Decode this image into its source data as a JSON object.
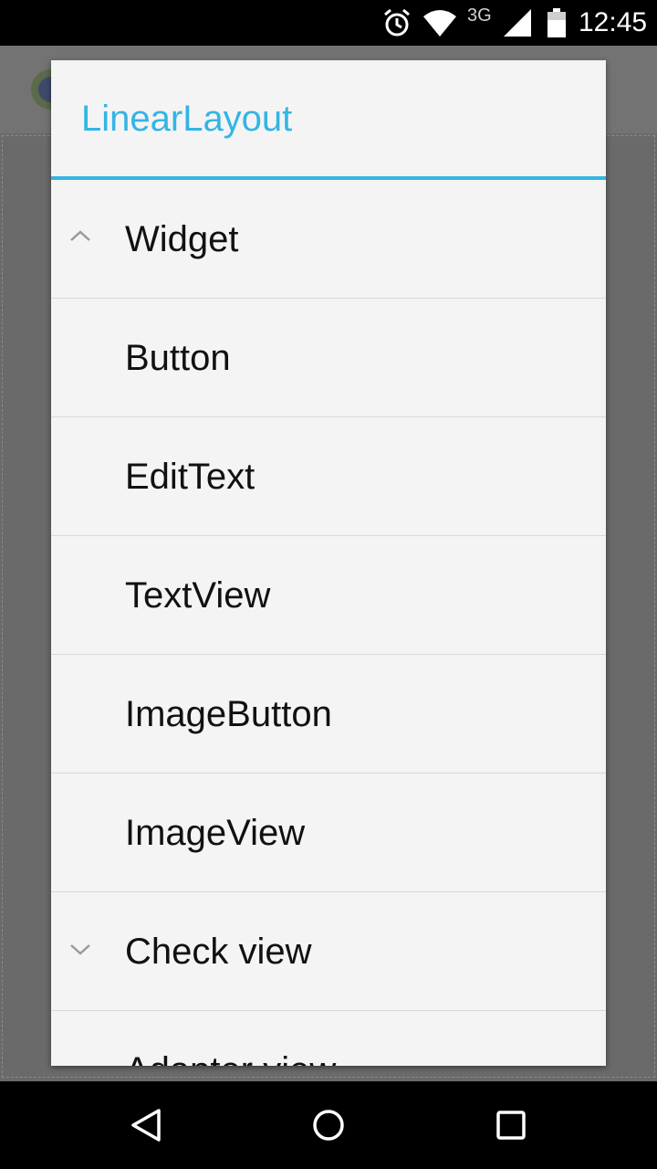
{
  "status_bar": {
    "network": "3G",
    "time": "12:45",
    "icons": [
      "alarm-icon",
      "wifi-icon",
      "signal-icon",
      "battery-icon"
    ]
  },
  "dialog": {
    "title": "LinearLayout",
    "accent_color": "#33b5e5",
    "items": [
      {
        "label": "Widget",
        "type": "group",
        "state": "expanded",
        "icon": "chevron-up-icon"
      },
      {
        "label": "Button",
        "type": "child"
      },
      {
        "label": "EditText",
        "type": "child"
      },
      {
        "label": "TextView",
        "type": "child"
      },
      {
        "label": "ImageButton",
        "type": "child"
      },
      {
        "label": "ImageView",
        "type": "child"
      },
      {
        "label": "Check view",
        "type": "group",
        "state": "collapsed",
        "icon": "chevron-down-icon"
      },
      {
        "label": "Adapter view",
        "type": "group",
        "state": "partially-visible"
      }
    ]
  },
  "nav_bar": {
    "icons": [
      "back-icon",
      "home-icon",
      "recent-apps-icon"
    ]
  }
}
